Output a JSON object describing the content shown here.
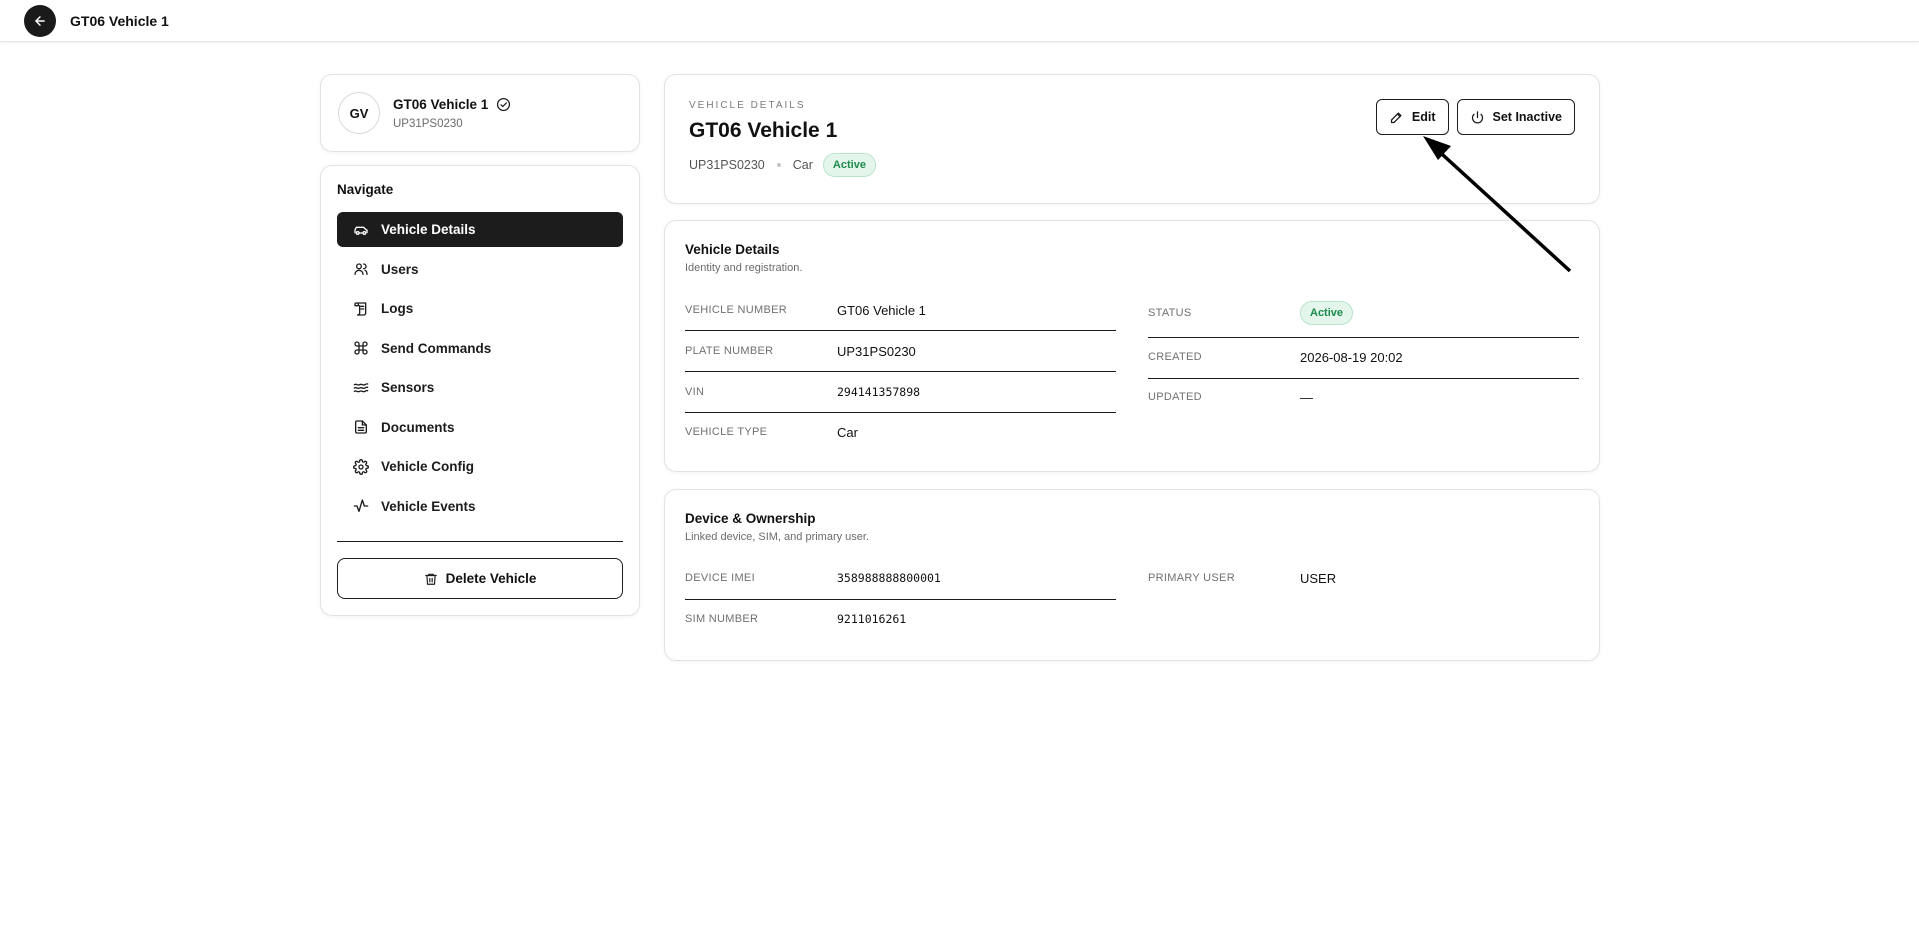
{
  "topbar": {
    "title": "GT06 Vehicle 1"
  },
  "profile": {
    "initials": "GV",
    "name": "GT06 Vehicle 1",
    "plate": "UP31PS0230"
  },
  "nav": {
    "heading": "Navigate",
    "items": [
      {
        "label": "Vehicle Details",
        "icon": "car-icon",
        "active": true
      },
      {
        "label": "Users",
        "icon": "users-icon"
      },
      {
        "label": "Logs",
        "icon": "scroll-icon"
      },
      {
        "label": "Send Commands",
        "icon": "command-icon"
      },
      {
        "label": "Sensors",
        "icon": "waves-icon"
      },
      {
        "label": "Documents",
        "icon": "document-icon"
      },
      {
        "label": "Vehicle Config",
        "icon": "gear-icon"
      },
      {
        "label": "Vehicle Events",
        "icon": "activity-icon"
      }
    ],
    "delete_label": "Delete Vehicle"
  },
  "header": {
    "eyebrow": "VEHICLE DETAILS",
    "title": "GT06 Vehicle 1",
    "plate": "UP31PS0230",
    "type": "Car",
    "status": "Active",
    "edit_label": "Edit",
    "inactive_label": "Set Inactive"
  },
  "details": {
    "title": "Vehicle Details",
    "subtitle": "Identity and registration.",
    "left": [
      {
        "label": "VEHICLE NUMBER",
        "value": "GT06 Vehicle 1"
      },
      {
        "label": "PLATE NUMBER",
        "value": "UP31PS0230"
      },
      {
        "label": "VIN",
        "value": "294141357898"
      },
      {
        "label": "VEHICLE TYPE",
        "value": "Car"
      }
    ],
    "right": [
      {
        "label": "STATUS",
        "value": "Active"
      },
      {
        "label": "CREATED",
        "value": "2026-08-19 20:02"
      },
      {
        "label": "UPDATED",
        "value": "—"
      }
    ]
  },
  "device": {
    "title": "Device & Ownership",
    "subtitle": "Linked device, SIM, and primary user.",
    "left": [
      {
        "label": "DEVICE IMEI",
        "value": "358988888800001"
      },
      {
        "label": "SIM NUMBER",
        "value": "9211016261"
      }
    ],
    "right": [
      {
        "label": "PRIMARY USER",
        "value": "USER"
      }
    ]
  },
  "colors": {
    "dark": "#1c1c1c",
    "success_bg": "#e4f6ec",
    "success_text": "#1c8a4b"
  }
}
